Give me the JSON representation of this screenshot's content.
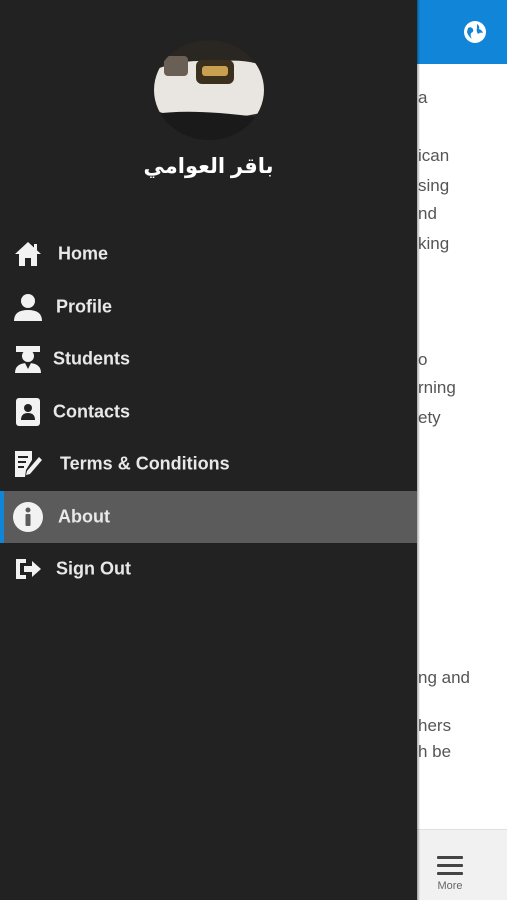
{
  "background": {
    "text_lines": [
      "a",
      "ican",
      "sing",
      "nd",
      "king",
      "o",
      "rning",
      "ety",
      "ng and",
      "hers",
      "h be"
    ],
    "bottom_nav": {
      "more_label": "More",
      "more_icon": "hamburger-icon"
    },
    "header_icon": "globe-icon"
  },
  "drawer": {
    "user_name": "باقر العوامي",
    "menu": [
      {
        "label": "Home",
        "icon": "home-icon"
      },
      {
        "label": "Profile",
        "icon": "person-icon"
      },
      {
        "label": "Students",
        "icon": "student-icon"
      },
      {
        "label": "Contacts",
        "icon": "contact-card-icon"
      },
      {
        "label": "Terms & Conditions",
        "icon": "document-edit-icon"
      },
      {
        "label": "About",
        "icon": "info-icon",
        "active": true
      },
      {
        "label": "Sign Out",
        "icon": "sign-out-icon"
      }
    ]
  },
  "colors": {
    "header": "#1186d8",
    "drawer_bg": "#222222",
    "active_item_bg": "#5b5b5b",
    "active_indicator": "#1186d8"
  }
}
